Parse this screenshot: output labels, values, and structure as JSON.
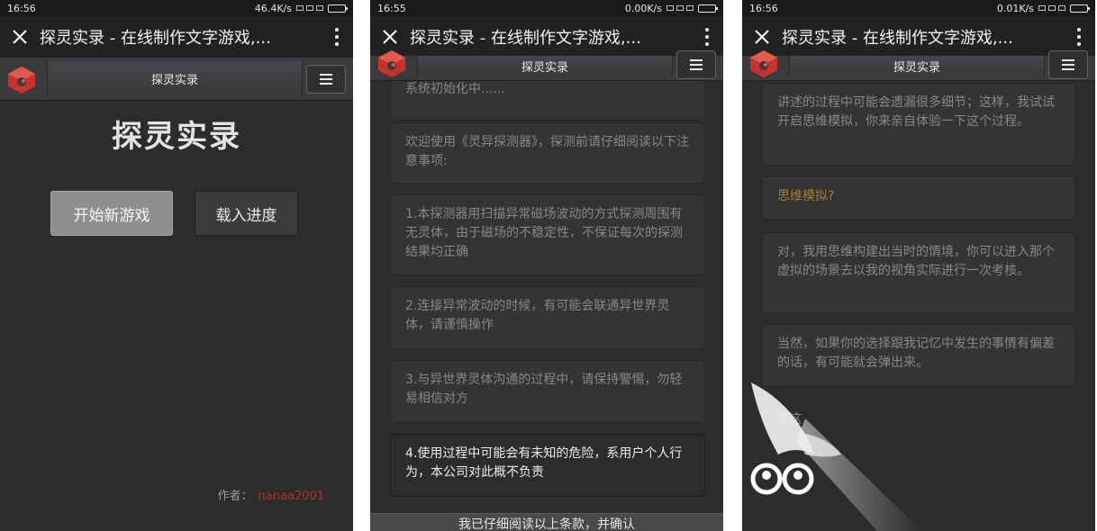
{
  "phones": [
    {
      "status": {
        "time": "16:56",
        "net": "46.4K/s"
      },
      "browser": {
        "title": "探灵实录 - 在线制作文字游戏,..."
      },
      "nav": {
        "label": "探灵实录"
      },
      "game": {
        "heading": "探灵实录",
        "new_game": "开始新游戏",
        "load_game": "载入进度",
        "author_label": "作者：",
        "author_name": "nanaa2001"
      }
    },
    {
      "status": {
        "time": "16:55",
        "net": "0.00K/s"
      },
      "browser": {
        "title": "探灵实录 - 在线制作文字游戏,..."
      },
      "nav": {
        "label": "探灵实录"
      },
      "messages": [
        "系统初始化中......",
        "欢迎使用《灵异探测器》，探测前请仔细阅读以下注意事项:",
        "1.本探测器用扫描异常磁场波动的方式探测周围有无灵体，由于磁场的不稳定性，不保证每次的探测结果均正确",
        "2.连接异常波动的时候，有可能会联通异世界灵体，请谨慎操作",
        "3.与异世界灵体沟通的过程中，请保持警惕，勿轻易相信对方",
        "4.使用过程中可能会有未知的危险，系用户个人行为，本公司对此概不负责"
      ],
      "confirm": "我已仔细阅读以上条款，并确认"
    },
    {
      "status": {
        "time": "16:56",
        "net": "0.01K/s"
      },
      "browser": {
        "title": "探灵实录 - 在线制作文字游戏,..."
      },
      "nav": {
        "label": "探灵实录"
      },
      "messages": [
        "讲述的过程中可能会遗漏很多细节；这样，我试试开启思维模拟，你来亲自体验一下这个过程。",
        "思维模拟?",
        "对，我用思维构建出当时的情境，你可以进入那个虚拟的场景去以我的视角实际进行一次考核。",
        "当然，如果你的选择跟我记忆中发生的事情有偏差的话，有可能就会弹出来。",
        "是这"
      ]
    }
  ],
  "colors": {
    "accent_red": "#b0332e",
    "option_orange": "#a77c2d",
    "background": "#2b2c2e"
  }
}
